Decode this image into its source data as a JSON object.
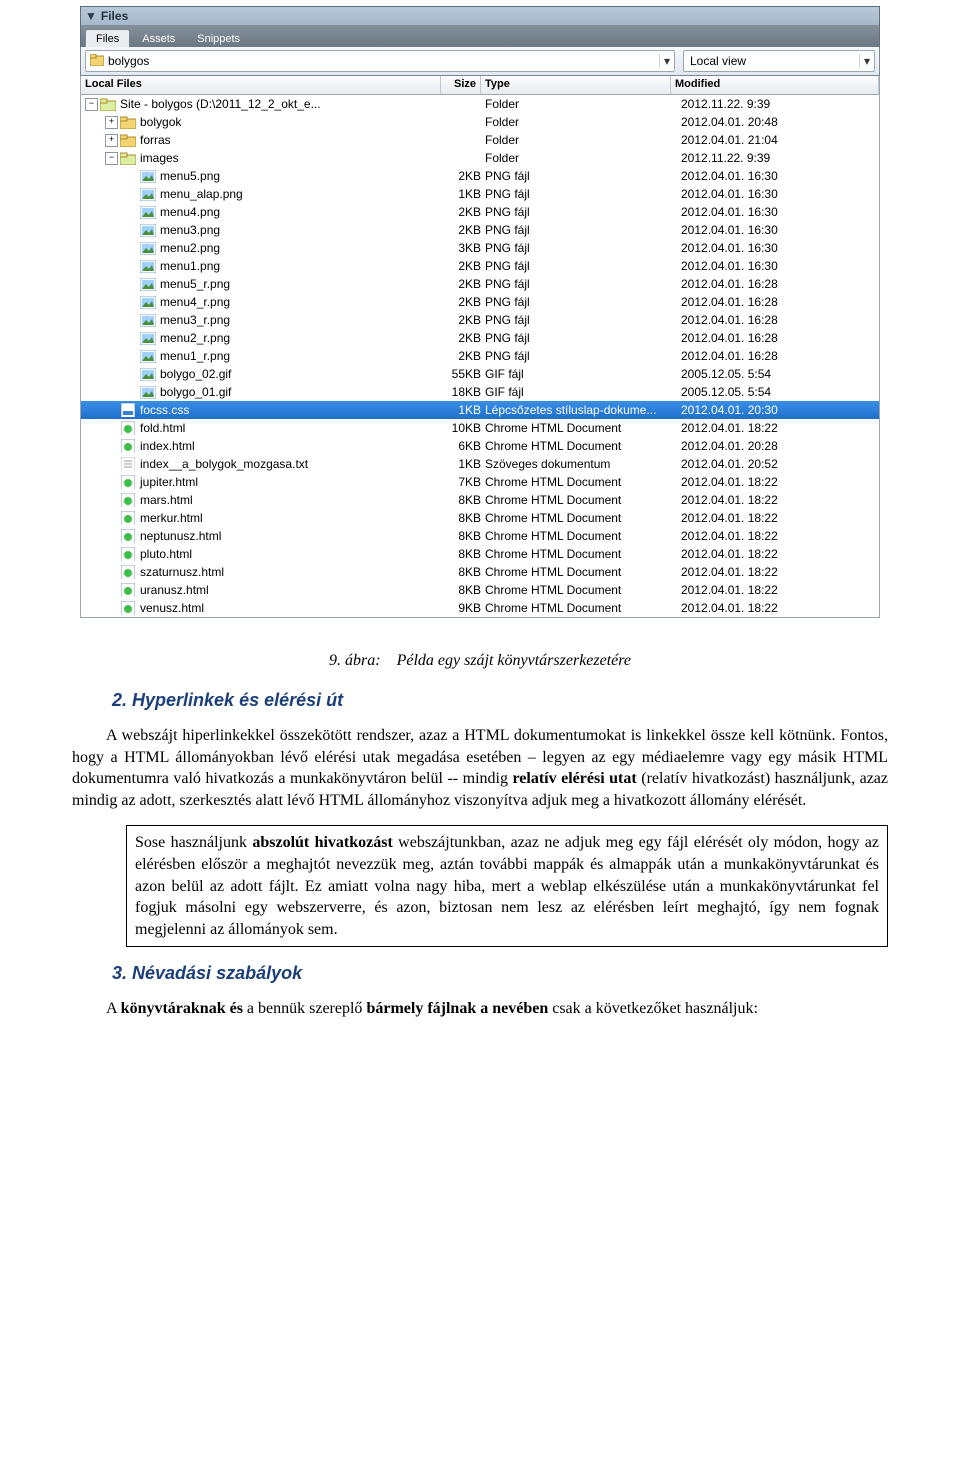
{
  "panel": {
    "title": "Files",
    "tabs": [
      "Files",
      "Assets",
      "Snippets"
    ],
    "active_tab_index": 0,
    "breadcrumb_combo": "bolygos",
    "view_combo": "Local view",
    "columns": [
      "Local Files",
      "Size",
      "Type",
      "Modified"
    ]
  },
  "tree": [
    {
      "depth": 0,
      "expand": "-",
      "icon": "folder-open",
      "name": "Site - bolygos (D:\\2011_12_2_okt_e...",
      "size": "",
      "type": "Folder",
      "mod": "2012.11.22. 9:39",
      "sel": false
    },
    {
      "depth": 1,
      "expand": "+",
      "icon": "folder",
      "name": "bolygok",
      "size": "",
      "type": "Folder",
      "mod": "2012.04.01. 20:48",
      "sel": false
    },
    {
      "depth": 1,
      "expand": "+",
      "icon": "folder",
      "name": "forras",
      "size": "",
      "type": "Folder",
      "mod": "2012.04.01. 21:04",
      "sel": false
    },
    {
      "depth": 1,
      "expand": "-",
      "icon": "folder-open",
      "name": "images",
      "size": "",
      "type": "Folder",
      "mod": "2012.11.22. 9:39",
      "sel": false
    },
    {
      "depth": 2,
      "expand": "",
      "icon": "img",
      "name": "menu5.png",
      "size": "2KB",
      "type": "PNG fájl",
      "mod": "2012.04.01. 16:30",
      "sel": false
    },
    {
      "depth": 2,
      "expand": "",
      "icon": "img",
      "name": "menu_alap.png",
      "size": "1KB",
      "type": "PNG fájl",
      "mod": "2012.04.01. 16:30",
      "sel": false
    },
    {
      "depth": 2,
      "expand": "",
      "icon": "img",
      "name": "menu4.png",
      "size": "2KB",
      "type": "PNG fájl",
      "mod": "2012.04.01. 16:30",
      "sel": false
    },
    {
      "depth": 2,
      "expand": "",
      "icon": "img",
      "name": "menu3.png",
      "size": "2KB",
      "type": "PNG fájl",
      "mod": "2012.04.01. 16:30",
      "sel": false
    },
    {
      "depth": 2,
      "expand": "",
      "icon": "img",
      "name": "menu2.png",
      "size": "3KB",
      "type": "PNG fájl",
      "mod": "2012.04.01. 16:30",
      "sel": false
    },
    {
      "depth": 2,
      "expand": "",
      "icon": "img",
      "name": "menu1.png",
      "size": "2KB",
      "type": "PNG fájl",
      "mod": "2012.04.01. 16:30",
      "sel": false
    },
    {
      "depth": 2,
      "expand": "",
      "icon": "img",
      "name": "menu5_r.png",
      "size": "2KB",
      "type": "PNG fájl",
      "mod": "2012.04.01. 16:28",
      "sel": false
    },
    {
      "depth": 2,
      "expand": "",
      "icon": "img",
      "name": "menu4_r.png",
      "size": "2KB",
      "type": "PNG fájl",
      "mod": "2012.04.01. 16:28",
      "sel": false
    },
    {
      "depth": 2,
      "expand": "",
      "icon": "img",
      "name": "menu3_r.png",
      "size": "2KB",
      "type": "PNG fájl",
      "mod": "2012.04.01. 16:28",
      "sel": false
    },
    {
      "depth": 2,
      "expand": "",
      "icon": "img",
      "name": "menu2_r.png",
      "size": "2KB",
      "type": "PNG fájl",
      "mod": "2012.04.01. 16:28",
      "sel": false
    },
    {
      "depth": 2,
      "expand": "",
      "icon": "img",
      "name": "menu1_r.png",
      "size": "2KB",
      "type": "PNG fájl",
      "mod": "2012.04.01. 16:28",
      "sel": false
    },
    {
      "depth": 2,
      "expand": "",
      "icon": "gif",
      "name": "bolygo_02.gif",
      "size": "55KB",
      "type": "GIF fájl",
      "mod": "2005.12.05. 5:54",
      "sel": false
    },
    {
      "depth": 2,
      "expand": "",
      "icon": "gif",
      "name": "bolygo_01.gif",
      "size": "18KB",
      "type": "GIF fájl",
      "mod": "2005.12.05. 5:54",
      "sel": false
    },
    {
      "depth": 1,
      "expand": "",
      "icon": "css",
      "name": "focss.css",
      "size": "1KB",
      "type": "Lépcsőzetes stíluslap-dokume...",
      "mod": "2012.04.01. 20:30",
      "sel": true
    },
    {
      "depth": 1,
      "expand": "",
      "icon": "html",
      "name": "fold.html",
      "size": "10KB",
      "type": "Chrome HTML Document",
      "mod": "2012.04.01. 18:22",
      "sel": false
    },
    {
      "depth": 1,
      "expand": "",
      "icon": "html",
      "name": "index.html",
      "size": "6KB",
      "type": "Chrome HTML Document",
      "mod": "2012.04.01. 20:28",
      "sel": false
    },
    {
      "depth": 1,
      "expand": "",
      "icon": "txt",
      "name": "index__a_bolygok_mozgasa.txt",
      "size": "1KB",
      "type": "Szöveges dokumentum",
      "mod": "2012.04.01. 20:52",
      "sel": false
    },
    {
      "depth": 1,
      "expand": "",
      "icon": "html",
      "name": "jupiter.html",
      "size": "7KB",
      "type": "Chrome HTML Document",
      "mod": "2012.04.01. 18:22",
      "sel": false
    },
    {
      "depth": 1,
      "expand": "",
      "icon": "html",
      "name": "mars.html",
      "size": "8KB",
      "type": "Chrome HTML Document",
      "mod": "2012.04.01. 18:22",
      "sel": false
    },
    {
      "depth": 1,
      "expand": "",
      "icon": "html",
      "name": "merkur.html",
      "size": "8KB",
      "type": "Chrome HTML Document",
      "mod": "2012.04.01. 18:22",
      "sel": false
    },
    {
      "depth": 1,
      "expand": "",
      "icon": "html",
      "name": "neptunusz.html",
      "size": "8KB",
      "type": "Chrome HTML Document",
      "mod": "2012.04.01. 18:22",
      "sel": false
    },
    {
      "depth": 1,
      "expand": "",
      "icon": "html",
      "name": "pluto.html",
      "size": "8KB",
      "type": "Chrome HTML Document",
      "mod": "2012.04.01. 18:22",
      "sel": false
    },
    {
      "depth": 1,
      "expand": "",
      "icon": "html",
      "name": "szaturnusz.html",
      "size": "8KB",
      "type": "Chrome HTML Document",
      "mod": "2012.04.01. 18:22",
      "sel": false
    },
    {
      "depth": 1,
      "expand": "",
      "icon": "html",
      "name": "uranusz.html",
      "size": "8KB",
      "type": "Chrome HTML Document",
      "mod": "2012.04.01. 18:22",
      "sel": false
    },
    {
      "depth": 1,
      "expand": "",
      "icon": "html",
      "name": "venusz.html",
      "size": "9KB",
      "type": "Chrome HTML Document",
      "mod": "2012.04.01. 18:22",
      "sel": false
    }
  ],
  "doc": {
    "caption_num": "9. ábra:",
    "caption_txt": "Példa egy szájt könyvtárszerkezetére",
    "sect2": "2. Hyperlinkek és elérési út",
    "p1a": "A webszájt hiperlinkekkel összekötött rendszer, azaz a HTML dokumentumokat is linkekkel össze kell kötnünk. Fontos, hogy a HTML állományokban lévő elérési utak megadása esetében – legyen az egy médiaelemre vagy egy másik HTML dokumentumra való hivatkozás a munkakönyvtáron belül -- mindig ",
    "p1b": "relatív elérési utat",
    "p1c": " (relatív hivatkozást) használjunk, azaz mindig az adott, szerkesztés alatt lévő HTML állományhoz viszonyítva adjuk meg a hivatkozott állomány elérését.",
    "note_a": "Sose használjunk ",
    "note_b": "abszolút hivatkozást",
    "note_c": " webszájtunkban, azaz ne adjuk meg egy fájl elérését oly módon, hogy az elérésben először a meghajtót nevezzük meg, aztán további mappák és almappák után a munkakönyvtárunkat és azon belül az adott fájlt. Ez amiatt volna nagy hiba, mert a weblap elkészülése után a munkakönyvtárunkat fel fogjuk másolni egy webszerverre, és azon, biztosan nem lesz az elérésben leírt meghajtó, így nem fognak megjelenni az állományok sem.",
    "sect3": "3. Névadási szabályok",
    "p3a": "A ",
    "p3b": "könyvtáraknak és",
    "p3c": " a bennük szereplő ",
    "p3d": "bármely fájlnak a nevében",
    "p3e": " csak a következőket használjuk:"
  }
}
